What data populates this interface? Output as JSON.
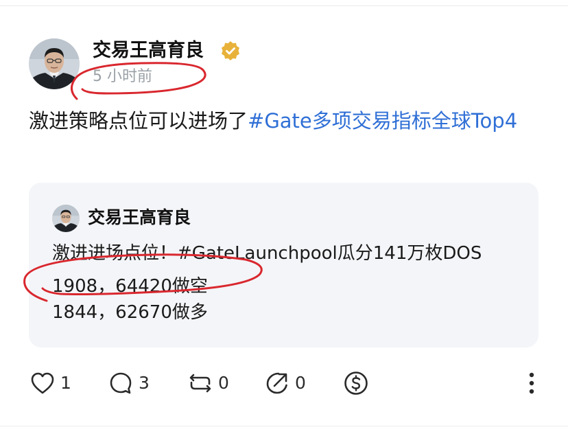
{
  "post": {
    "author": "交易王高育良",
    "verified": true,
    "timestamp": "5 小时前",
    "text_prefix": "激进策略点位可以进场了",
    "hashtag": "#Gate多项交易指标全球Top4"
  },
  "quoted_post": {
    "author": "交易王高育良",
    "line1": "激进进场点位！#GateLaunchpool瓜分141万枚DOS",
    "line2": "1908，64420做空",
    "line3": "1844，62670做多"
  },
  "actions": {
    "like_count": "1",
    "comment_count": "3",
    "repost_count": "0",
    "share_count": "0"
  },
  "icons": {
    "verified": "verified-badge-icon",
    "like": "heart-icon",
    "comment": "comment-bubble-icon",
    "repost": "repost-icon",
    "share": "share-icon",
    "tip": "tip-dollar-icon",
    "more": "more-vertical-icon"
  },
  "colors": {
    "hashtag": "#2f6fd6",
    "verified_badge": "#e8b23a",
    "annotation_ink": "#d9272e",
    "card_background": "#f4f5f8",
    "muted_text": "#9aa0a6"
  }
}
